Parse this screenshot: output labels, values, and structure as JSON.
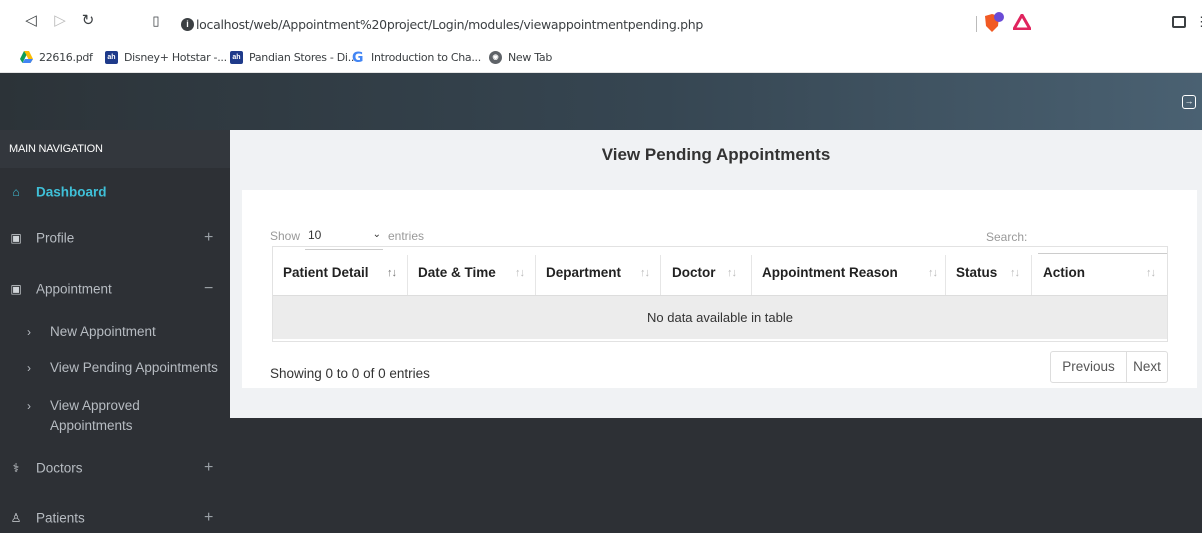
{
  "browser": {
    "url": "localhost/web/Appointment%20project/Login/modules/viewappointmentpending.php",
    "back_icon": "back-arrow-icon",
    "forward_icon": "forward-arrow-icon",
    "reload_icon": "reload-icon",
    "bookmarks": [
      {
        "label": "22616.pdf",
        "icon": "google-drive-icon"
      },
      {
        "label": "Disney+ Hotstar -...",
        "icon": "site-icon"
      },
      {
        "label": "Pandian Stores - Di...",
        "icon": "site-icon"
      },
      {
        "label": "Introduction to Cha...",
        "icon": "g-icon"
      },
      {
        "label": "New Tab",
        "icon": "globe-icon"
      }
    ]
  },
  "sidebar": {
    "header": "MAIN NAVIGATION",
    "items": [
      {
        "label": "Dashboard",
        "icon": "home-icon",
        "active": true
      },
      {
        "label": "Profile",
        "icon": "calendar-icon",
        "toggle": "+"
      },
      {
        "label": "Appointment",
        "icon": "calendar-icon",
        "toggle": "−"
      },
      {
        "label": "Doctors",
        "icon": "user-plus-icon",
        "toggle": "+"
      },
      {
        "label": "Patients",
        "icon": "user-icon",
        "toggle": "+"
      }
    ],
    "sub_items": [
      {
        "label": "New Appointment"
      },
      {
        "label": "View Pending Appointments"
      },
      {
        "label": "View Approved Appointments",
        "line1": "View Approved",
        "line2": "Appointments"
      }
    ]
  },
  "main": {
    "title": "View Pending Appointments",
    "show_label": "Show",
    "show_value": "10",
    "entries_label": "entries",
    "search_label": "Search:",
    "search_value": "",
    "columns": [
      "Patient Detail",
      "Date & Time",
      "Department",
      "Doctor",
      "Appointment Reason",
      "Status",
      "Action"
    ],
    "empty_message": "No data available in table",
    "info": "Showing 0 to 0 of 0 entries",
    "previous_label": "Previous",
    "next_label": "Next"
  },
  "colors": {
    "accent": "#3fc0d8",
    "sidebar_bg": "#2d3035"
  }
}
